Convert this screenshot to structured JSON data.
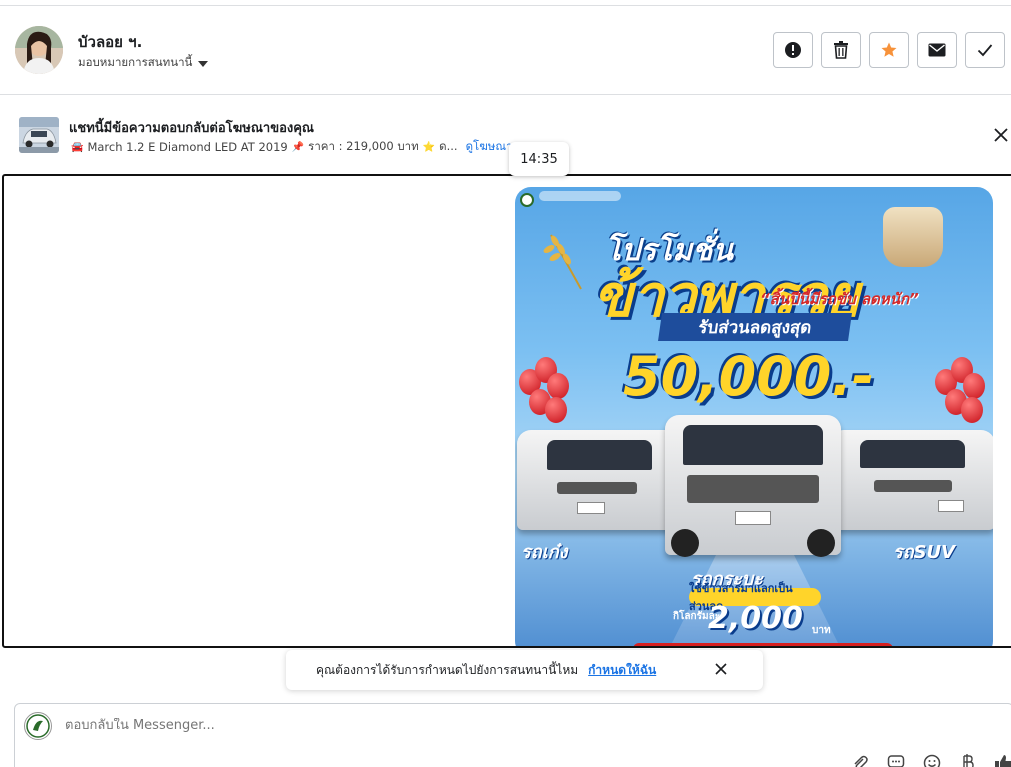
{
  "header": {
    "user_name": "บัวลอย ฯ.",
    "assign_label": "มอบหมายการสนทนานี้",
    "actions": [
      {
        "name": "report-spam",
        "icon": "alert-icon"
      },
      {
        "name": "delete",
        "icon": "trash-icon"
      },
      {
        "name": "star",
        "icon": "star-icon"
      },
      {
        "name": "mark-unread",
        "icon": "envelope-icon"
      },
      {
        "name": "mark-done",
        "icon": "check-icon"
      }
    ]
  },
  "ad_banner": {
    "title": "แชทนี้มีข้อความตอบกลับต่อโฆษณาของคุณ",
    "car_emoji": "🚘",
    "pin_emoji": "📌",
    "star_emoji": "⭐",
    "model": "March 1.2 E Diamond LED AT 2019",
    "price": "ราคา : 219,000 บาท",
    "ellipsis": "ด...",
    "view_ad_link": "ดูโฆษณา"
  },
  "message": {
    "timestamp": "14:35"
  },
  "promo_image": {
    "title_line1": "โปรโมชั่น",
    "title_line2": "ข้าวพารวย",
    "tagline": "“สิ้นปีนี้มีรถขับ ลดหนัก”",
    "discount_label": "รับส่วนลดสูงสุด",
    "discount_amount": "50,000.-",
    "car_left": "รถเก๋ง",
    "car_center": "รถกระบะ",
    "car_right": "รถSUV",
    "rice_offer": "ใช้ข้าวสารมาแลกเป็นส่วนลด",
    "per_kg": "กิโลกรัมละ",
    "rice_amount": "2,000",
    "baht": "บาท"
  },
  "reminder": {
    "text": "คุณต้องการได้รับการกำหนดไปยังการสนทนานี้ไหม",
    "link": "กำหนดให้ฉัน"
  },
  "composer": {
    "placeholder": "ตอบกลับใน Messenger...",
    "tools": [
      "attach-icon",
      "saved-reply-icon",
      "emoji-icon",
      "baht-icon",
      "like-icon"
    ]
  },
  "colors": {
    "accent": "#1b74e4",
    "star": "#f7923a"
  }
}
